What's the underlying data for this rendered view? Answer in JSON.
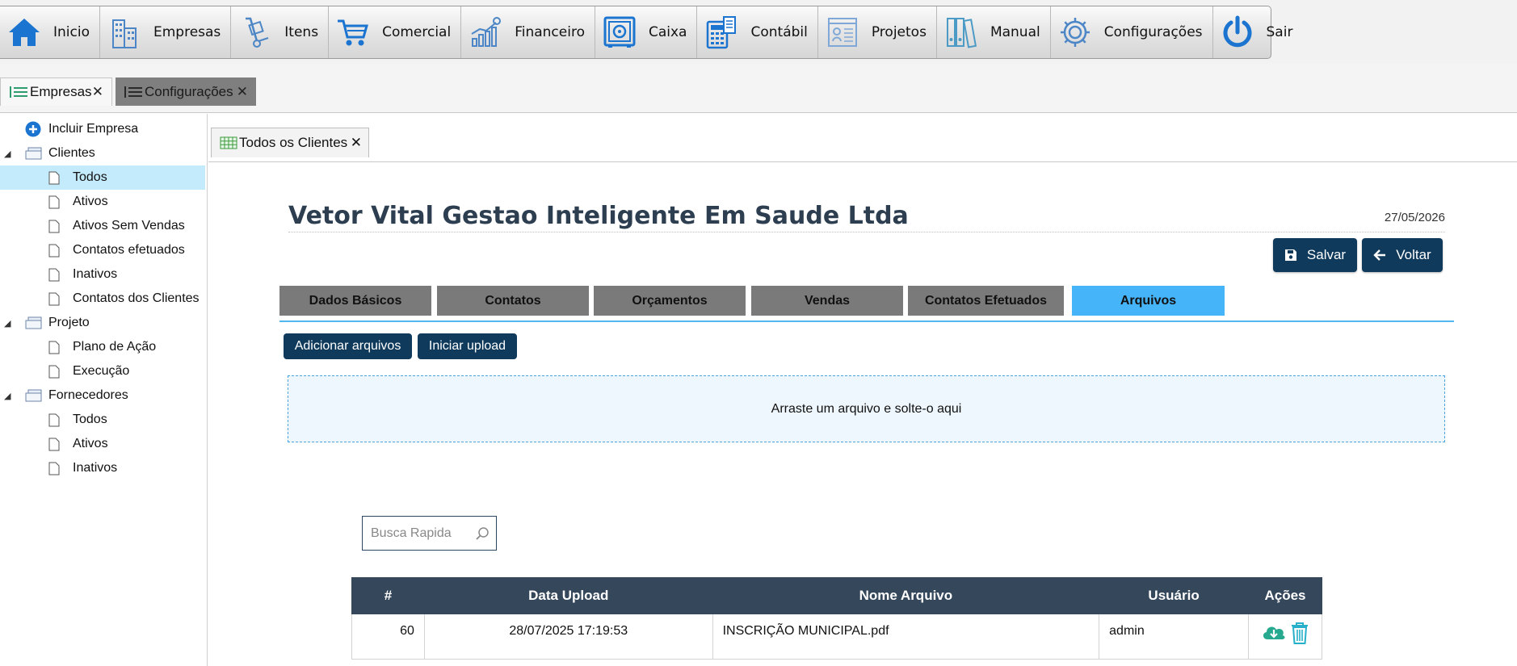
{
  "menu": [
    {
      "label": "Inicio",
      "icon": "home-icon"
    },
    {
      "label": "Empresas",
      "icon": "buildings-icon"
    },
    {
      "label": "Itens",
      "icon": "hand-truck-icon"
    },
    {
      "label": "Comercial",
      "icon": "cart-icon"
    },
    {
      "label": "Financeiro",
      "icon": "chart-icon"
    },
    {
      "label": "Caixa",
      "icon": "safe-icon"
    },
    {
      "label": "Contábil",
      "icon": "calculator-icon"
    },
    {
      "label": "Projetos",
      "icon": "blueprint-icon"
    },
    {
      "label": "Manual",
      "icon": "binders-icon"
    },
    {
      "label": "Configurações",
      "icon": "gear-icon"
    },
    {
      "label": "Sair",
      "icon": "power-icon"
    }
  ],
  "open_tabs": [
    {
      "label": "Empresas",
      "active": true
    },
    {
      "label": "Configurações",
      "active": false
    }
  ],
  "sidebar": {
    "add_company": "Incluir Empresa",
    "groups": [
      {
        "label": "Clientes",
        "items": [
          "Todos",
          "Ativos",
          "Ativos Sem Vendas",
          "Contatos efetuados",
          "Inativos",
          "Contatos dos Clientes"
        ]
      },
      {
        "label": "Projeto",
        "items": [
          "Plano de Ação",
          "Execução"
        ]
      },
      {
        "label": "Fornecedores",
        "items": [
          "Todos",
          "Ativos",
          "Inativos"
        ]
      }
    ],
    "selected": "Clientes/Todos"
  },
  "inner_tab": {
    "label": "Todos os Clientes"
  },
  "company": {
    "name": "Vetor Vital Gestao Inteligente Em Saude Ltda",
    "date": "27/05/2026"
  },
  "actions": {
    "save": "Salvar",
    "back": "Voltar"
  },
  "tabs": [
    "Dados Básicos",
    "Contatos",
    "Orçamentos",
    "Vendas",
    "Contatos Efetuados",
    "Arquivos"
  ],
  "active_tab": "Arquivos",
  "upload": {
    "add_files": "Adicionar arquivos",
    "start_upload": "Iniciar upload",
    "dropzone": "Arraste um arquivo e solte-o aqui"
  },
  "search": {
    "placeholder": "Busca Rapida"
  },
  "files_table": {
    "columns": [
      "#",
      "Data Upload",
      "Nome Arquivo",
      "Usuário",
      "Ações"
    ],
    "rows": [
      {
        "id": "60",
        "date": "28/07/2025 17:19:53",
        "name": "INSCRIÇÃO MUNICIPAL.pdf",
        "user": "admin"
      }
    ]
  },
  "colors": {
    "accent_tab": "#46b4f8",
    "dark_button": "#0f3a5c",
    "table_header": "#34475b",
    "selected_row": "#c4ebfb"
  }
}
